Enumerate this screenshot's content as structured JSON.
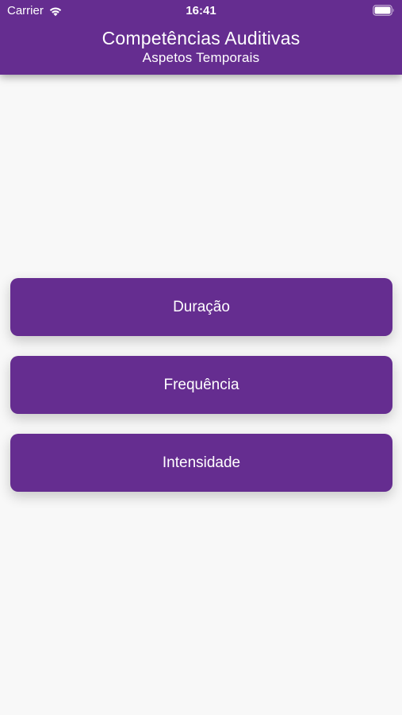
{
  "status_bar": {
    "carrier": "Carrier",
    "time": "16:41",
    "icons": [
      "wifi-icon",
      "battery-icon"
    ]
  },
  "header": {
    "title": "Competências Auditivas",
    "subtitle": "Aspetos Temporais",
    "background": "#652d90"
  },
  "menu": {
    "items": [
      {
        "label": "Duração"
      },
      {
        "label": "Frequência"
      },
      {
        "label": "Intensidade"
      }
    ],
    "button_color": "#652d90",
    "text_color": "#ffffff"
  },
  "page_background": "#f8f8f8"
}
